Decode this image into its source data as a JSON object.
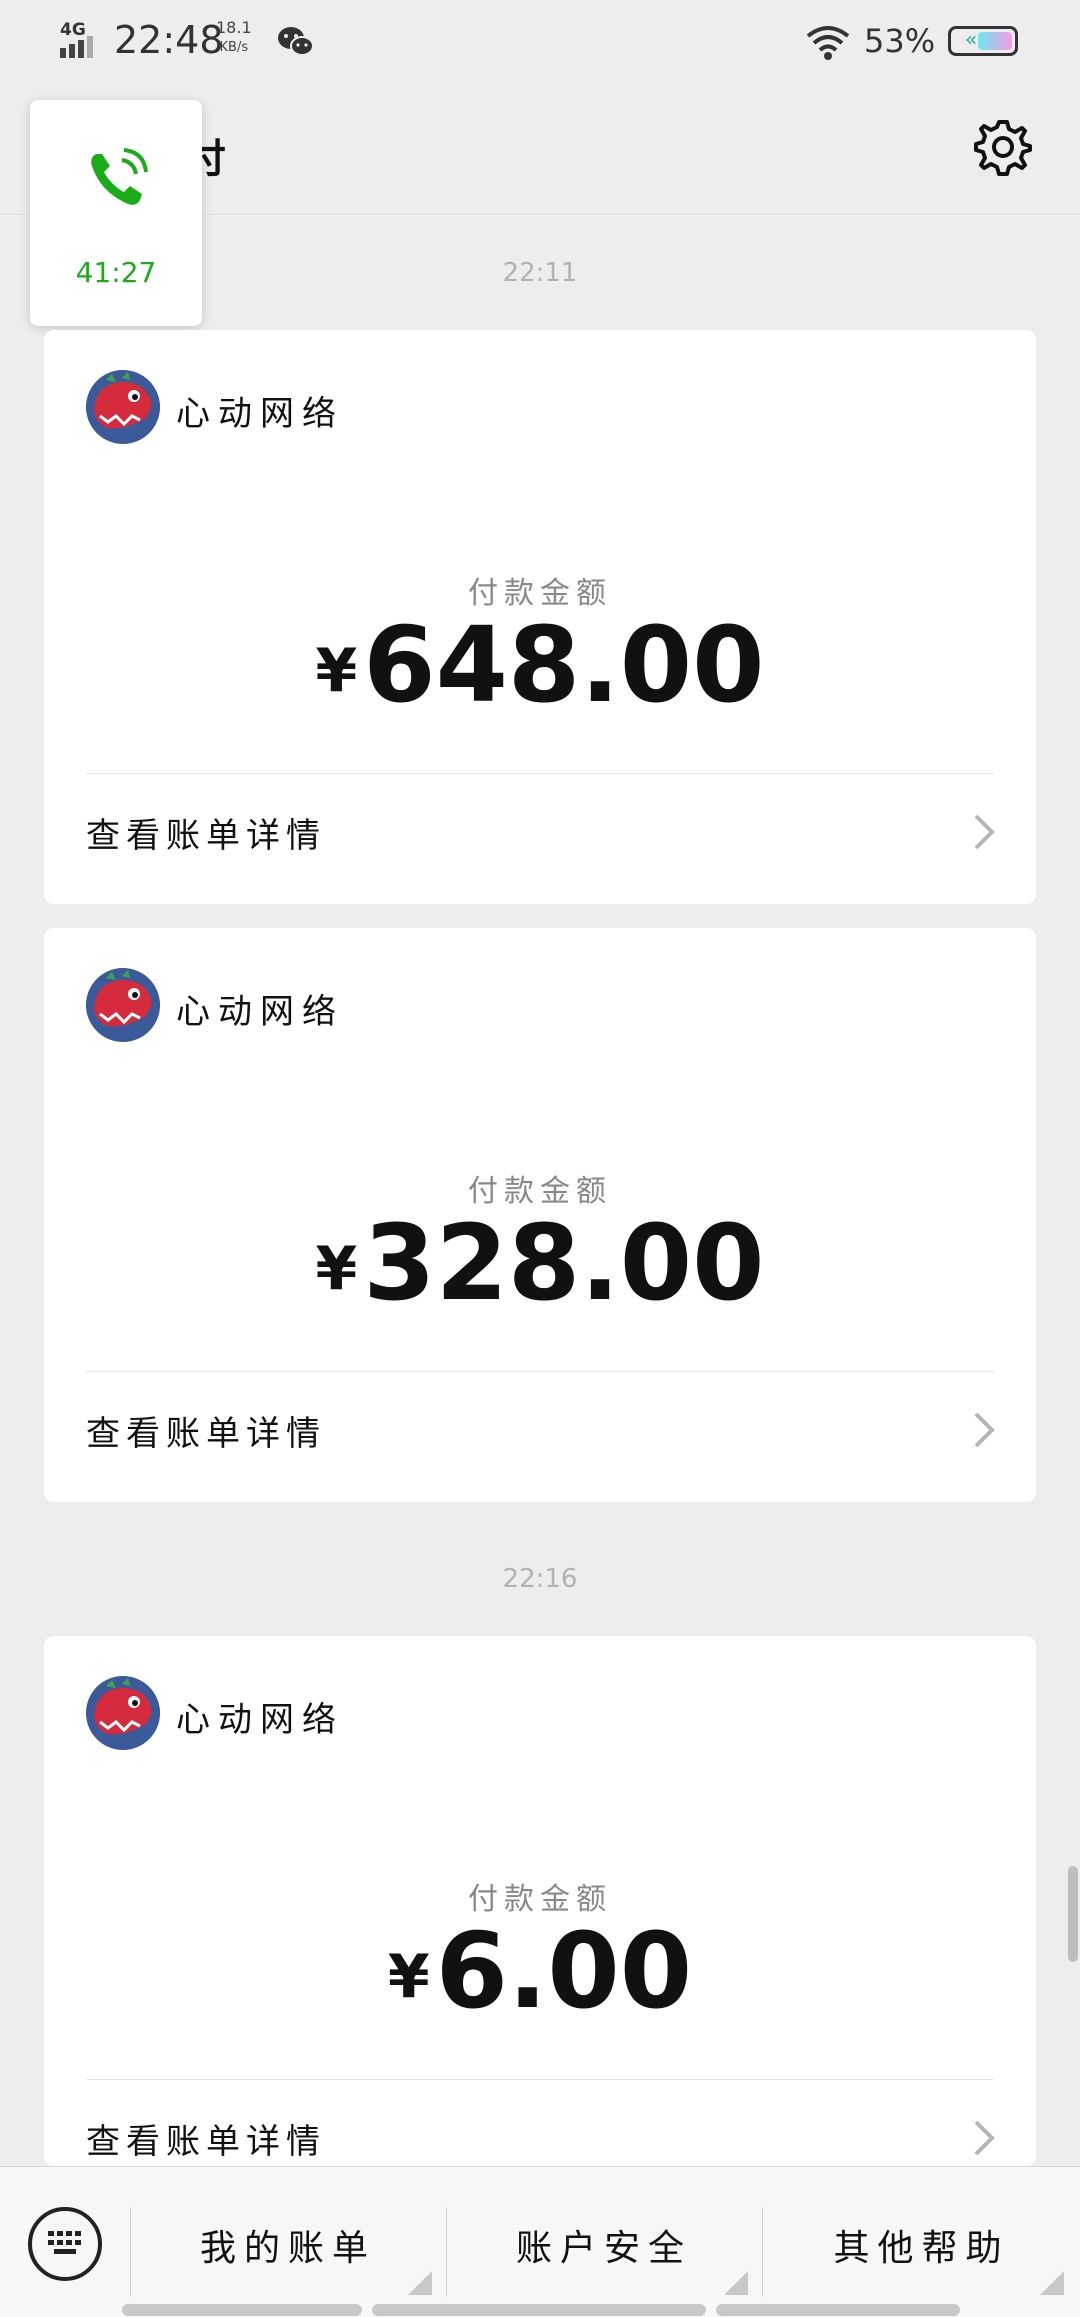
{
  "status_bar": {
    "network": "4G",
    "time": "22:48",
    "speed_value": "18.1",
    "speed_unit": "KB/s",
    "battery": "53%"
  },
  "header": {
    "title": "支付",
    "settings_icon": "gear-icon"
  },
  "call": {
    "duration": "41:27",
    "color": "#1aad19"
  },
  "groups": [
    {
      "time": "22:11"
    },
    {
      "time": "22:16"
    }
  ],
  "cards": [
    {
      "merchant": "心动网络",
      "amount_label": "付款金额",
      "currency": "¥",
      "amount": "648.00",
      "detail": "查看账单详情"
    },
    {
      "merchant": "心动网络",
      "amount_label": "付款金额",
      "currency": "¥",
      "amount": "328.00",
      "detail": "查看账单详情"
    },
    {
      "merchant": "心动网络",
      "amount_label": "付款金额",
      "currency": "¥",
      "amount": "6.00",
      "detail": "查看账单详情"
    }
  ],
  "bottom_menu": {
    "keyboard_icon": "keyboard-icon",
    "items": [
      "我的账单",
      "账户安全",
      "其他帮助"
    ]
  }
}
